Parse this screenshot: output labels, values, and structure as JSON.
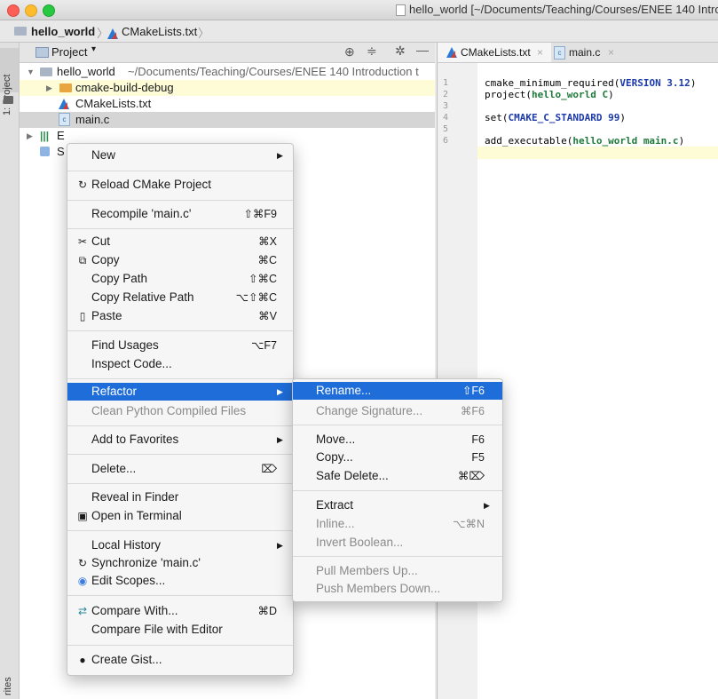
{
  "window": {
    "title": "hello_world [~/Documents/Teaching/Courses/ENEE 140 Introduc",
    "traffic_lights": [
      "#fc5f57",
      "#fdbc2e",
      "#28c840"
    ]
  },
  "navbar": {
    "crumb1": "hello_world",
    "crumb2": "CMakeLists.txt"
  },
  "left_stripe": {
    "project": "1: Project",
    "favorites": "rites"
  },
  "project_panel": {
    "view_label": "Project",
    "tree": [
      {
        "label": "hello_world",
        "detail": "~/Documents/Teaching/Courses/ENEE 140 Introduction t"
      },
      {
        "label": "cmake-build-debug"
      },
      {
        "label": "CMakeLists.txt"
      },
      {
        "label": "main.c"
      },
      {
        "label": "E"
      },
      {
        "label": "S"
      }
    ]
  },
  "editor": {
    "tabs": [
      "CMakeLists.txt",
      "main.c"
    ],
    "lines": [
      "1",
      "2",
      "3",
      "4",
      "5",
      "6"
    ],
    "code": [
      {
        "a": "cmake_minimum_required(",
        "b": "VERSION 3.12",
        "c": ")"
      },
      {
        "a": "project(",
        "b": "hello_world C",
        "c": ")"
      },
      {
        "a": "",
        "b": "",
        "c": ""
      },
      {
        "a": "set(",
        "b": "CMAKE_C_STANDARD 99",
        "c": ")"
      },
      {
        "a": "",
        "b": "",
        "c": ""
      },
      {
        "a": "add_executable(",
        "b": "hello_world main.c",
        "c": ")"
      }
    ]
  },
  "context_menu": {
    "new": "New",
    "reload": "Reload CMake Project",
    "recompile": "Recompile 'main.c'",
    "recompile_sc": "⇧⌘F9",
    "cut": "Cut",
    "cut_sc": "⌘X",
    "copy": "Copy",
    "copy_sc": "⌘C",
    "copy_path": "Copy Path",
    "copy_path_sc": "⇧⌘C",
    "copy_rel": "Copy Relative Path",
    "copy_rel_sc": "⌥⇧⌘C",
    "paste": "Paste",
    "paste_sc": "⌘V",
    "find_usages": "Find Usages",
    "find_usages_sc": "⌥F7",
    "inspect": "Inspect Code...",
    "refactor": "Refactor",
    "clean_py": "Clean Python Compiled Files",
    "add_fav": "Add to Favorites",
    "delete": "Delete...",
    "delete_sc": "⌦",
    "reveal": "Reveal in Finder",
    "terminal": "Open in Terminal",
    "local_history": "Local History",
    "sync": "Synchronize 'main.c'",
    "edit_scopes": "Edit Scopes...",
    "compare": "Compare With...",
    "compare_sc": "⌘D",
    "compare_editor": "Compare File with Editor",
    "gist": "Create Gist..."
  },
  "refactor_menu": {
    "rename": "Rename...",
    "rename_sc": "⇧F6",
    "change_sig": "Change Signature...",
    "change_sig_sc": "⌘F6",
    "move": "Move...",
    "move_sc": "F6",
    "copy": "Copy...",
    "copy_sc": "F5",
    "safe_delete": "Safe Delete...",
    "safe_delete_sc": "⌘⌦",
    "extract": "Extract",
    "inline": "Inline...",
    "inline_sc": "⌥⌘N",
    "invert": "Invert Boolean...",
    "pull_up": "Pull Members Up...",
    "push_down": "Push Members Down..."
  },
  "colors": {
    "selection": "#1e6dd9",
    "keyword": "#1c3aa9",
    "param": "#1f7a3a",
    "highlight_row": "#fdfcd6"
  }
}
